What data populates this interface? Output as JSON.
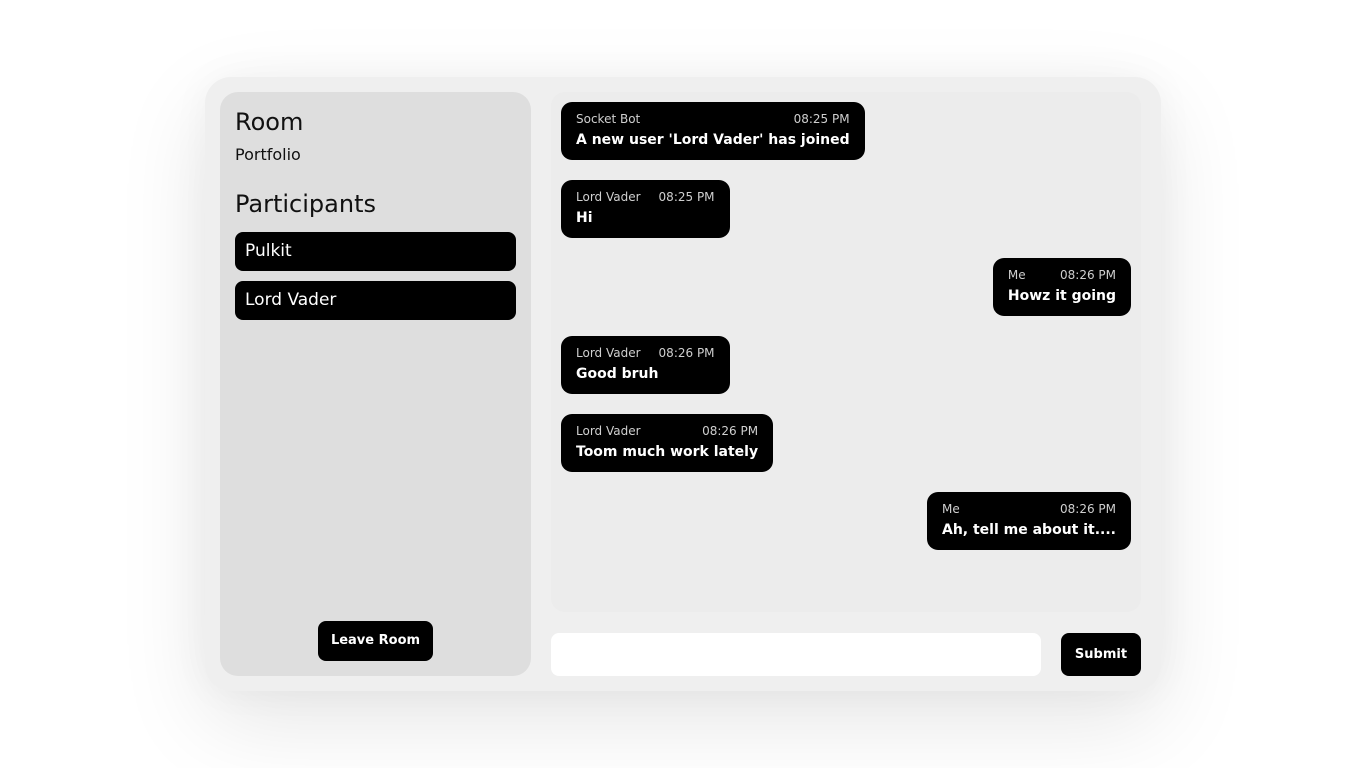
{
  "sidebar": {
    "room_heading": "Room",
    "room_name": "Portfolio",
    "participants_heading": "Participants",
    "participants": [
      "Pulkit",
      "Lord Vader"
    ],
    "leave_label": "Leave Room"
  },
  "messages": [
    {
      "sender": "Socket Bot",
      "time": "08:25 PM",
      "text": "A new user 'Lord Vader' has joined",
      "align": "left"
    },
    {
      "sender": "Lord Vader",
      "time": "08:25 PM",
      "text": "Hi",
      "align": "left"
    },
    {
      "sender": "Me",
      "time": "08:26 PM",
      "text": "Howz it going",
      "align": "right"
    },
    {
      "sender": "Lord Vader",
      "time": "08:26 PM",
      "text": "Good bruh",
      "align": "left"
    },
    {
      "sender": "Lord Vader",
      "time": "08:26 PM",
      "text": "Toom much work lately",
      "align": "left"
    },
    {
      "sender": "Me",
      "time": "08:26 PM",
      "text": "Ah, tell me about it....",
      "align": "right"
    }
  ],
  "composer": {
    "value": "",
    "placeholder": "",
    "submit_label": "Submit"
  },
  "colors": {
    "bubble": "#000000",
    "panel": "#dedede",
    "app_background": "#efefef"
  }
}
